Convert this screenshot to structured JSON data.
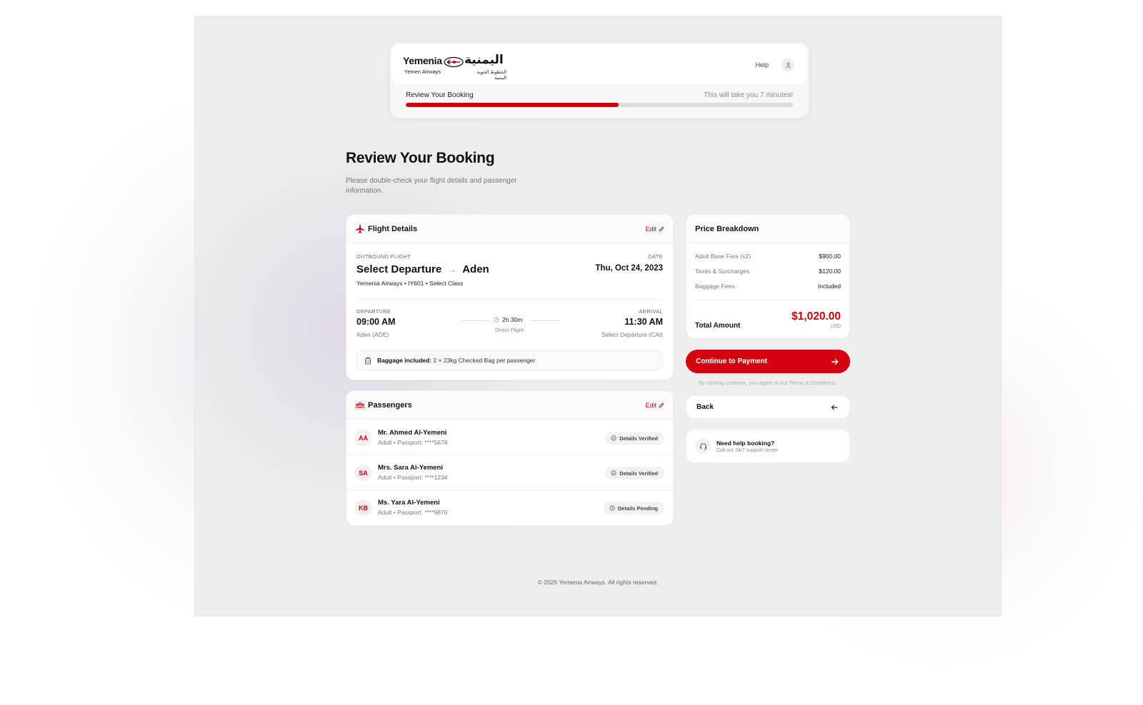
{
  "header": {
    "logo_en": "Yemenia",
    "logo_en_sub": "Yemen Airways",
    "logo_ar": "اليمنية",
    "logo_ar_sub": "الخطوط الجوية اليمنية",
    "help_label": "Help",
    "progress_label": "Review Your Booking",
    "progress_note": "This will take you 7 minutes!",
    "progress_fraction": 0.55
  },
  "page": {
    "title": "Review Your Booking",
    "subtitle": "Please double-check your flight details and passenger information."
  },
  "flight": {
    "title": "Flight Details",
    "edit_label": "Edit",
    "outbound_label": "OUTBOUND FLIGHT",
    "origin": "Select Departure",
    "destination": "Aden",
    "route_sub": "Yemenia Airways • IY601 • Select Class",
    "date_label": "DATE",
    "date": "Thu, Oct 24, 2023",
    "departure_label": "DEPARTURE",
    "departure_time": "09:00 AM",
    "departure_airport": "Aden (ADE)",
    "duration": "2h 30m",
    "flight_type": "Direct Flight",
    "arrival_label": "ARRIVAL",
    "arrival_time": "11:30 AM",
    "arrival_airport": "Select Departure (CAI)",
    "baggage_label": "Baggage included:",
    "baggage_text": "2 × 23kg Checked Bag per passenger"
  },
  "passengers": {
    "title": "Passengers",
    "edit_label": "Edit",
    "items": [
      {
        "initials": "AA",
        "name": "Mr. Ahmed Al-Yemeni",
        "meta": "Adult • Passport: ****5678",
        "status": "Details Verified"
      },
      {
        "initials": "SA",
        "name": "Mrs. Sara Al-Yemeni",
        "meta": "Adult • Passport: ****1234",
        "status": "Details Verified"
      },
      {
        "initials": "KB",
        "name": "Ms. Yara Al-Yemeni",
        "meta": "Adult • Passport: ****9876",
        "status": "Details Pending"
      }
    ]
  },
  "price": {
    "title": "Price Breakdown",
    "rows": [
      {
        "label": "Adult Base Fare (x2)",
        "value": "$900.00"
      },
      {
        "label": "Taxes & Surcharges",
        "value": "$120.00"
      },
      {
        "label": "Baggage Fees",
        "value": "Included"
      }
    ],
    "total_label": "Total Amount",
    "total_value": "$1,020.00",
    "currency": "USD"
  },
  "actions": {
    "pay_label": "Continue to Payment",
    "terms": "By clicking continue, you agree to our Terms & Conditions.",
    "back_label": "Back",
    "help_title": "Need help booking?",
    "help_sub": "Call our 24/7 support center"
  },
  "footer": {
    "copyright": "© 2026 Yemenia Airways. All rights reserved."
  },
  "colors": {
    "accent": "#d40010",
    "page_bg": "#efeeef",
    "card_bg": "#ffffff"
  },
  "icons": {
    "flight": "plane-icon",
    "passengers": "users-icon",
    "edit": "pencil-icon",
    "arrow_right": "arrow-right-icon",
    "arrow_left": "arrow-left-icon",
    "clock": "clock-icon",
    "luggage": "luggage-icon",
    "verified": "check-circle-icon",
    "headset": "headset-icon",
    "user": "user-icon"
  }
}
